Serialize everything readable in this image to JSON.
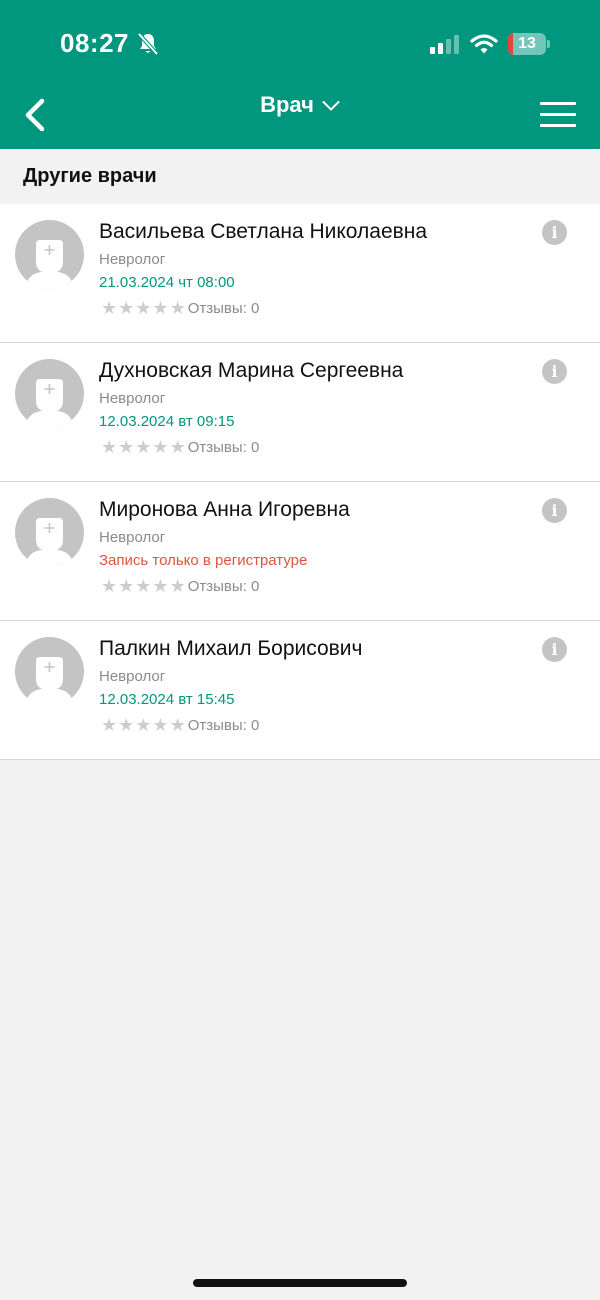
{
  "status_bar": {
    "time": "08:27",
    "battery_level": "13",
    "battery_fraction": 0.13,
    "icons": [
      "bell-slash-icon",
      "signal-icon",
      "wifi-icon",
      "battery-icon"
    ]
  },
  "nav": {
    "title": "Врач",
    "back_icon": "chevron-left-icon",
    "dropdown_icon": "chevron-down-icon",
    "menu_icon": "hamburger-menu-icon"
  },
  "section": {
    "title": "Другие врачи"
  },
  "doctors": [
    {
      "name": "Васильева Светлана Николаевна",
      "specialty": "Невролог",
      "slot": "21.03.2024 чт 08:00",
      "slot_type": "green",
      "rating": 0,
      "reviews": "Отзывы: 0"
    },
    {
      "name": "Духновская Марина Сергеевна",
      "specialty": "Невролог",
      "slot": "12.03.2024 вт 09:15",
      "slot_type": "green",
      "rating": 0,
      "reviews": "Отзывы: 0"
    },
    {
      "name": "Миронова Анна Игоревна",
      "specialty": "Невролог",
      "slot": "Запись только в регистратуре",
      "slot_type": "red",
      "rating": 0,
      "reviews": "Отзывы: 0"
    },
    {
      "name": "Палкин Михаил Борисович",
      "specialty": "Невролог",
      "slot": "12.03.2024 вт 15:45",
      "slot_type": "green",
      "rating": 0,
      "reviews": "Отзывы: 0"
    }
  ],
  "info_glyph": "i",
  "colors": {
    "brand": "#00977e",
    "warning": "#e0553d",
    "muted": "#8b8b8b"
  }
}
